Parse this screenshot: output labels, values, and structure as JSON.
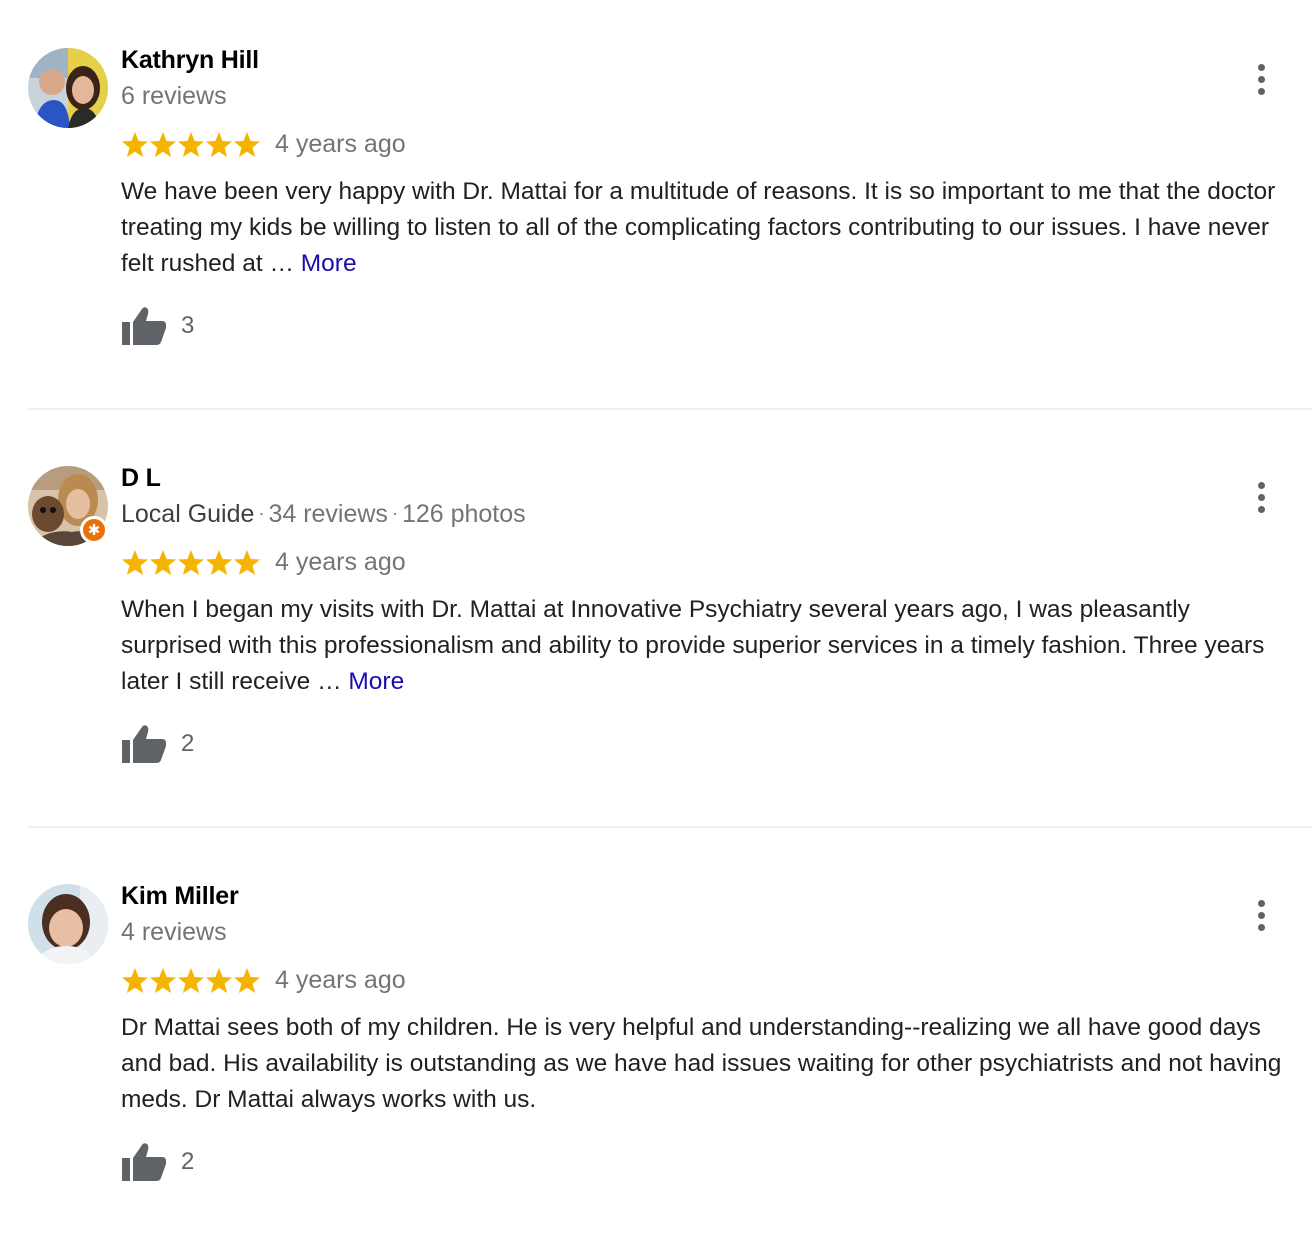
{
  "reviews": [
    {
      "author": "Kathryn Hill",
      "local_guide": "",
      "reviews_count": "6 reviews",
      "photos_count": "",
      "rating": 5,
      "time": "4 years ago",
      "text": "We have been very happy with Dr. Mattai for a multitude of reasons. It is so important to me that the doctor treating my kids be willing to listen to all of the complicating factors contributing to our issues. I have never felt rushed at",
      "ellipsis": "…",
      "more_label": "More",
      "likes": "3"
    },
    {
      "author": "D L",
      "local_guide": "Local Guide",
      "reviews_count": "34 reviews",
      "photos_count": "126 photos",
      "rating": 5,
      "time": "4 years ago",
      "text": "When I began my visits with Dr. Mattai at Innovative Psychiatry several years ago, I was pleasantly surprised with this professionalism and ability to provide superior services in a timely fashion. Three years later I still receive",
      "ellipsis": "…",
      "more_label": "More",
      "likes": "2"
    },
    {
      "author": "Kim Miller",
      "local_guide": "",
      "reviews_count": "4 reviews",
      "photos_count": "",
      "rating": 5,
      "time": "4 years ago",
      "text": "Dr Mattai sees both of my children. He is very helpful and understanding--realizing we all have good days and bad. His availability is outstanding as we have had issues waiting for other psychiatrists and not having meds. Dr Mattai always works with us.",
      "ellipsis": "",
      "more_label": "",
      "likes": "2"
    }
  ],
  "separator": "·",
  "icons": {
    "star": "star-icon",
    "menu": "more-vert-icon",
    "like": "thumb-up-icon",
    "guide_badge": "local-guide-star-icon"
  },
  "colors": {
    "star": "#f4b400",
    "link": "#1a0dab",
    "secondary_text": "#70757a",
    "icon": "#5f6368",
    "local_guide_badge": "#e8710a"
  }
}
